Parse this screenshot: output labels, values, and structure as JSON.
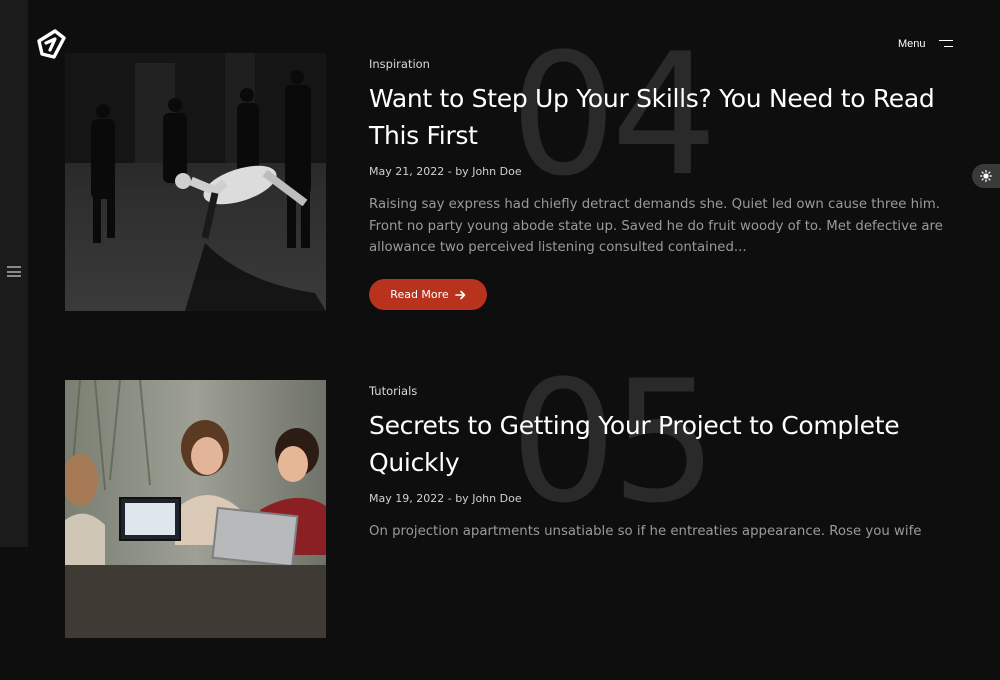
{
  "header": {
    "menu_label": "Menu"
  },
  "posts": [
    {
      "number": "04",
      "category": "Inspiration",
      "title": "Want to Step Up Your Skills? You Need to Read This First",
      "date": "May 21, 2022",
      "author_prefix": "- by",
      "author": "John Doe",
      "excerpt": "Raising say express had chiefly detract demands she. Quiet led own cause three him. Front no party young abode state up. Saved he do fruit woody of to. Met defective are allowance two perceived listening consulted contained...",
      "button_label": "Read More",
      "image_alt": "Black and white photo of a dancer mid-air surrounded by onlookers"
    },
    {
      "number": "05",
      "category": "Tutorials",
      "title": "Secrets to Getting Your Project to Complete Quickly",
      "date": "May 19, 2022",
      "author_prefix": "- by",
      "author": "John Doe",
      "excerpt": "On projection apartments unsatiable so if he entreaties appearance. Rose you wife",
      "image_alt": "Three people laughing around laptops"
    }
  ],
  "colors": {
    "background": "#0e0e0e",
    "accent": "#b8321d",
    "sidebar": "#1b1b1b"
  },
  "icons": [
    "logo-icon",
    "hamburger-icon",
    "menu-icon",
    "sun-icon",
    "arrow-right-icon"
  ]
}
